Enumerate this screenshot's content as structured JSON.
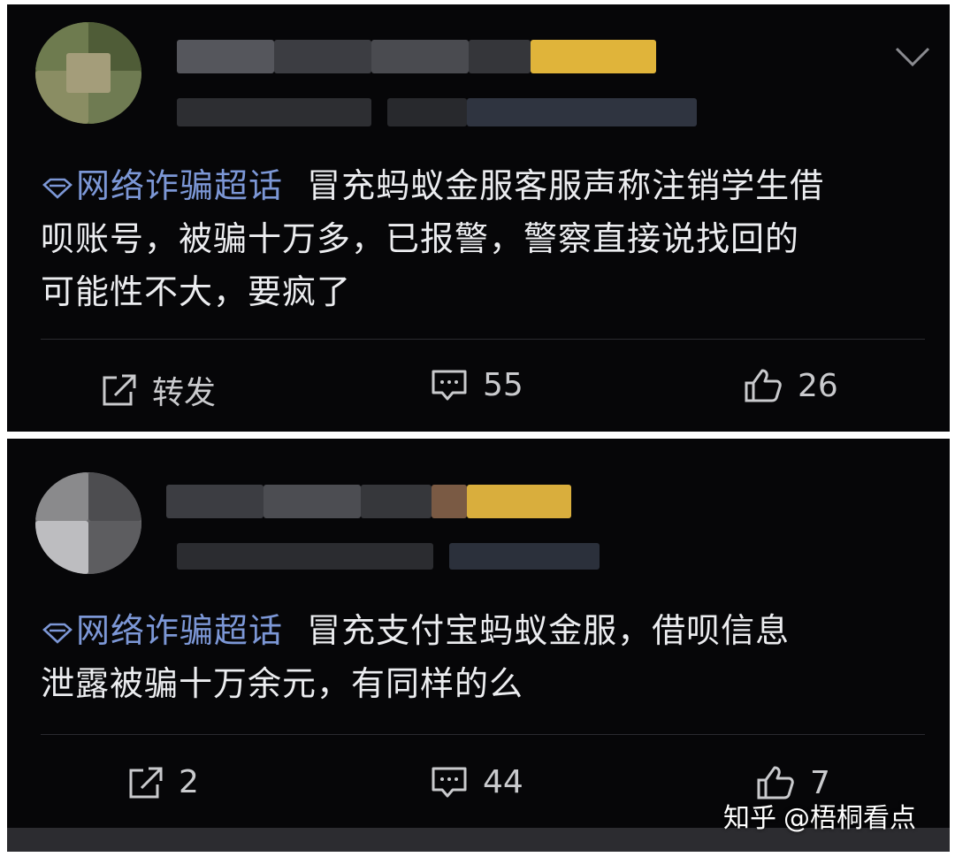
{
  "posts": [
    {
      "topic": "网络诈骗超话",
      "text_line1": "冒充蚂蚁金服客服声称注销学生借",
      "text_line2": "呗账号，被骗十万多，已报警，警察直接说找回的",
      "text_line3": "可能性不大，要疯了",
      "repost_label": "转发",
      "comment_count": "55",
      "like_count": "26"
    },
    {
      "topic": "网络诈骗超话",
      "text_line1": "冒充支付宝蚂蚁金服，借呗信息",
      "text_line2": "泄露被骗十万余元，有同样的么",
      "repost_label": "2",
      "comment_count": "44",
      "like_count": "7"
    }
  ],
  "watermark": {
    "site": "知乎",
    "handle": "@梧桐看点"
  },
  "icons": {
    "topic": "diamond-icon",
    "repost": "share-icon",
    "comment": "comment-icon",
    "like": "thumbs-up-icon",
    "menu": "chevron-down-icon"
  },
  "colors": {
    "background": "#060608",
    "text": "#ecedf0",
    "topic": "#7c97d6",
    "action": "#c9cacd",
    "badge": "#e0b43a"
  }
}
